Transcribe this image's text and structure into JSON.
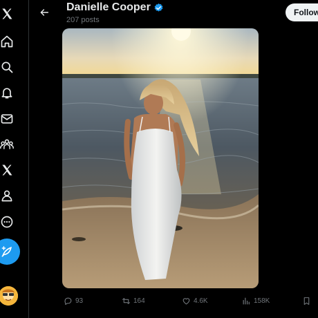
{
  "profile": {
    "name": "Danielle Cooper",
    "posts": "207 posts",
    "follow_label": "Follow"
  },
  "post": {
    "replies": "93",
    "reposts": "164",
    "likes": "4.6K",
    "views": "158K"
  },
  "icons": {
    "sidebar": [
      "x-logo-icon",
      "home-icon",
      "search-icon",
      "notifications-icon",
      "messages-icon",
      "communities-icon",
      "premium-x-icon",
      "profile-icon",
      "more-icon",
      "compose-icon"
    ],
    "header": [
      "back-arrow-icon",
      "verified-badge-icon"
    ],
    "actions": [
      "reply-icon",
      "repost-icon",
      "like-icon",
      "views-icon",
      "bookmark-icon"
    ]
  },
  "colors": {
    "background": "#000000",
    "accent": "#1d9bf0",
    "muted_text": "#71767b",
    "follow_button": "#eff3f4"
  }
}
